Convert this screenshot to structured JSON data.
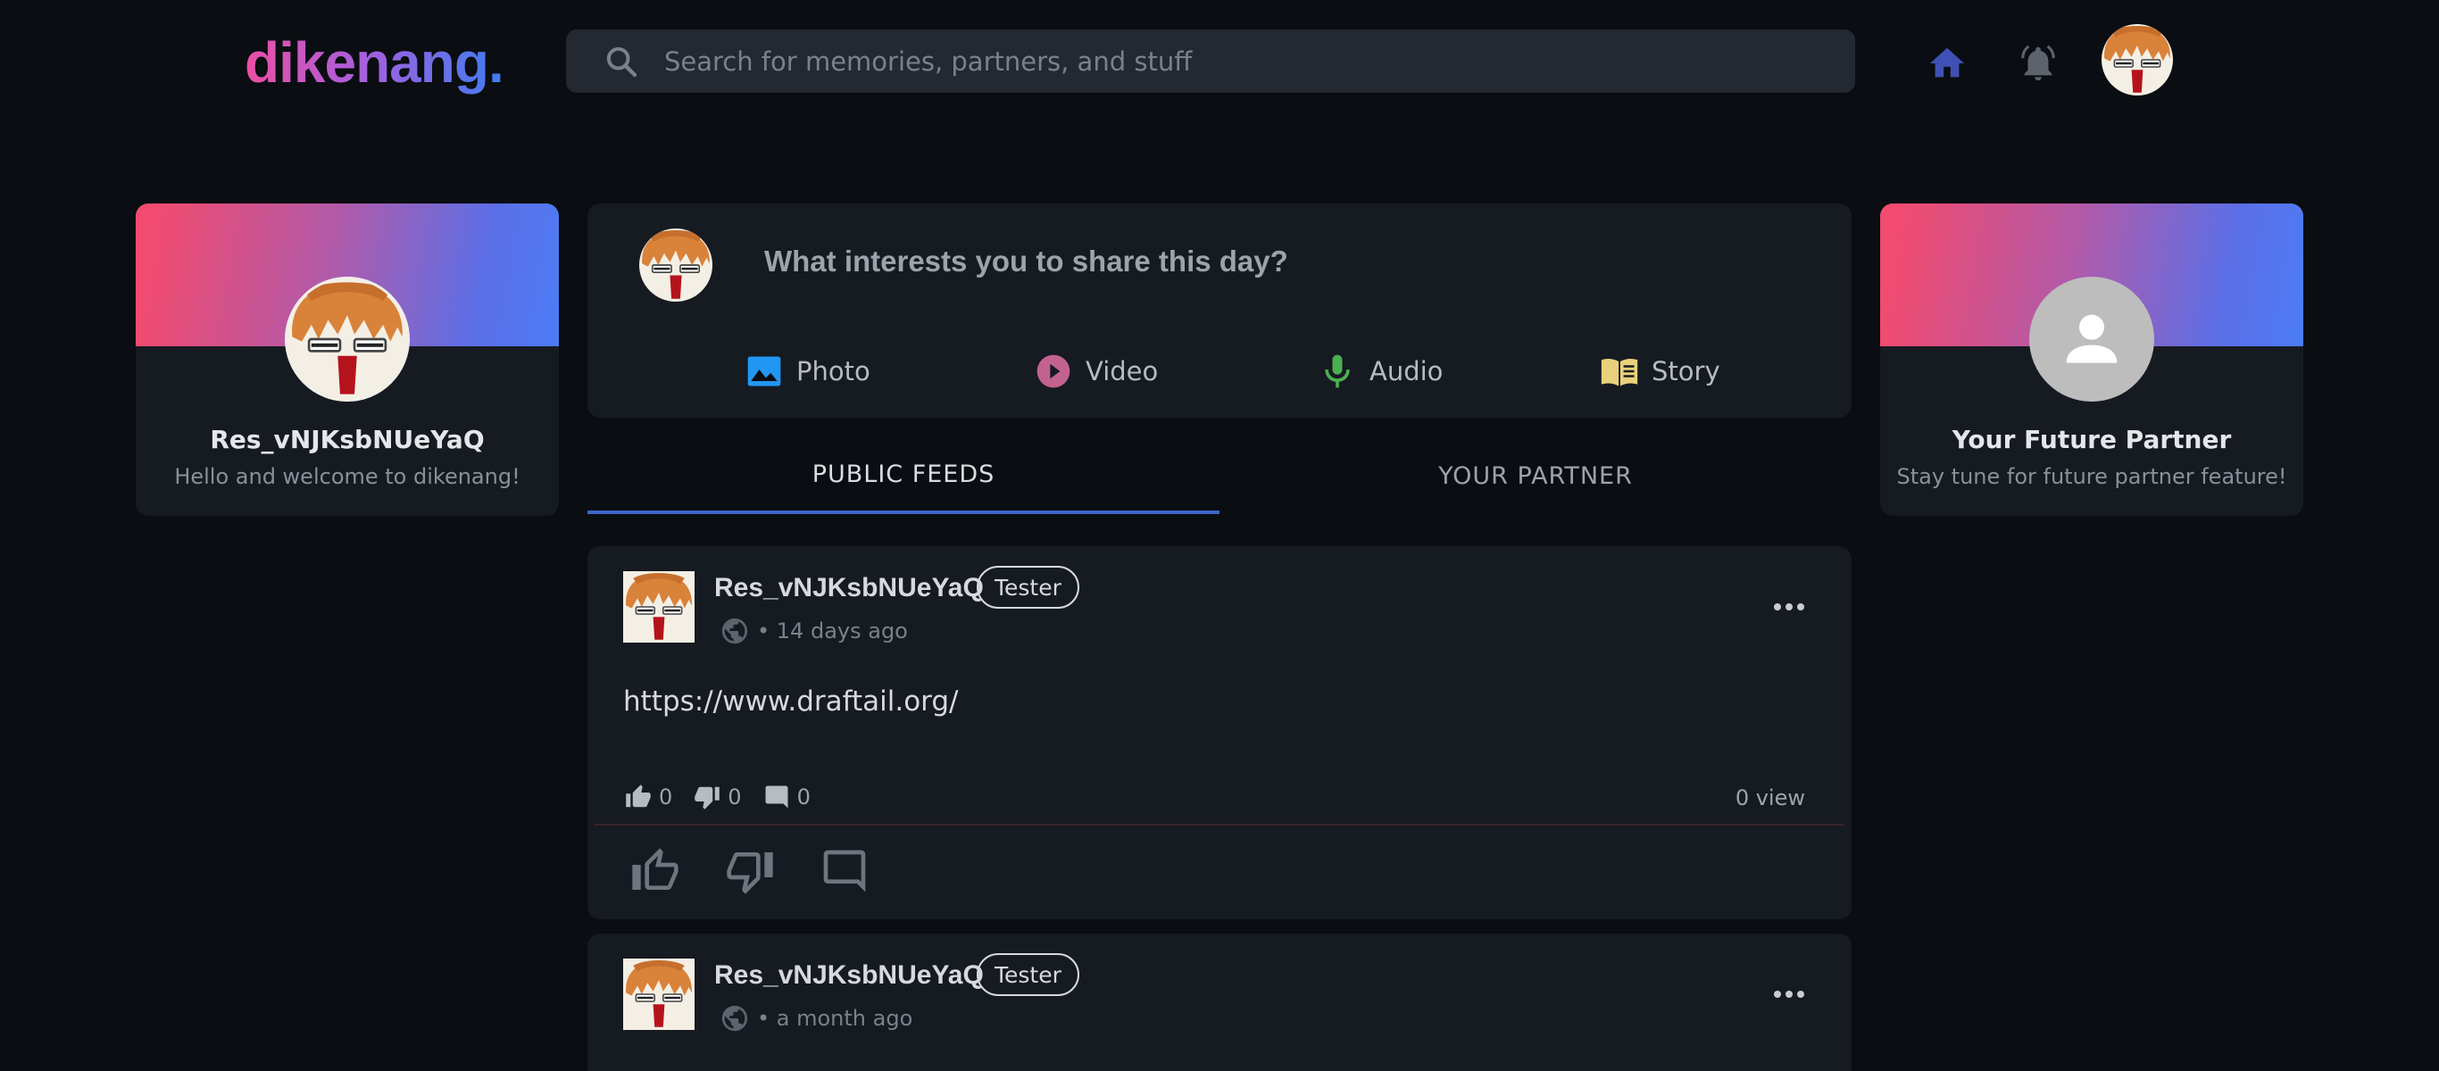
{
  "header": {
    "logo": "dikenang.",
    "search": {
      "placeholder": "Search for memories, partners, and stuff",
      "value": ""
    },
    "icons": [
      "search-icon",
      "home-icon",
      "bell-icon"
    ]
  },
  "colors": {
    "background": "#0a0d11",
    "card": "#161a21",
    "accent": "#3d66c9",
    "home_icon": "#3f51b5",
    "logo_gradient": [
      "#ec4fa5",
      "#a75fdc",
      "#3f7cf2"
    ],
    "banner_gradient": [
      "#f14b6f",
      "#b35aa8",
      "#4b7cf5"
    ]
  },
  "profile_card": {
    "username": "Res_vNJKsbNUeYaQ",
    "welcome": "Hello and welcome to dikenang!"
  },
  "composer": {
    "prompt": "What interests you to share this day?",
    "actions": [
      {
        "label": "Photo",
        "icon": "photo-icon",
        "color": "#2196f3"
      },
      {
        "label": "Video",
        "icon": "play-circle-icon",
        "color": "#c2628f"
      },
      {
        "label": "Audio",
        "icon": "microphone-icon",
        "color": "#4caf50"
      },
      {
        "label": "Story",
        "icon": "book-icon",
        "color": "#e8d17a"
      }
    ]
  },
  "tabs": [
    {
      "label": "PUBLIC FEEDS",
      "active": true
    },
    {
      "label": "YOUR PARTNER",
      "active": false
    }
  ],
  "partner_card": {
    "title": "Your Future Partner",
    "subtitle": "Stay tune for future partner feature!"
  },
  "posts": [
    {
      "author": "Res_vNJKsbNUeYaQ",
      "badge": "Tester",
      "time": "• 14 days ago",
      "content": "https://www.draftail.org/",
      "likes": "0",
      "dislikes": "0",
      "comments": "0",
      "views": "0 view"
    },
    {
      "author": "Res_vNJKsbNUeYaQ",
      "badge": "Tester",
      "time": "• a month ago"
    }
  ]
}
